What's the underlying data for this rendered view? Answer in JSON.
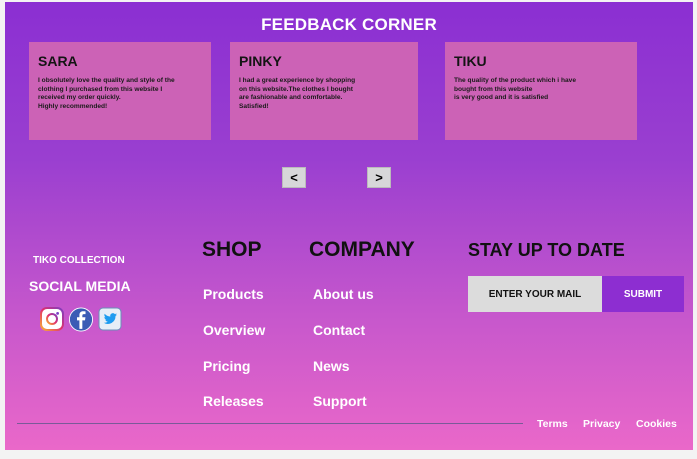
{
  "feedback": {
    "title": "FEEDBACK CORNER",
    "cards": [
      {
        "name": "SARA",
        "text": "I obsolutely love the quality and style of the\nclothing I purchased from this website I\nreceived my order quickly.\nHighly recommended!"
      },
      {
        "name": "PINKY",
        "text": "I had a great experience by shopping\non this website.The clothes I bought\nare fashionable and comfortable.\n Satisfied!"
      },
      {
        "name": "TIKU",
        "text": "The quality of the product which i have\n bought from this website\nis very good and it is satisfied"
      }
    ],
    "prev_label": "<",
    "next_label": ">"
  },
  "footer": {
    "brand": "TIKO COLLECTION",
    "social_title": "SOCIAL MEDIA",
    "social_icons": [
      "instagram-icon",
      "facebook-icon",
      "twitter-icon"
    ],
    "shop": {
      "heading": "SHOP",
      "links": [
        "Products",
        "Overview",
        "Pricing",
        "Releases"
      ]
    },
    "company": {
      "heading": "COMPANY",
      "links": [
        "About us",
        "Contact",
        "News",
        "Support"
      ]
    },
    "newsletter": {
      "heading": "STAY UP TO DATE",
      "placeholder": "ENTER YOUR MAIL",
      "submit_label": "SUBMIT"
    },
    "legal": [
      "Terms",
      "Privacy",
      "Cookies"
    ]
  },
  "colors": {
    "gradient_top": "#8b2fd2",
    "gradient_bottom": "#ea68c9",
    "card": "#cc62b6",
    "submit": "#8d2ed1"
  }
}
